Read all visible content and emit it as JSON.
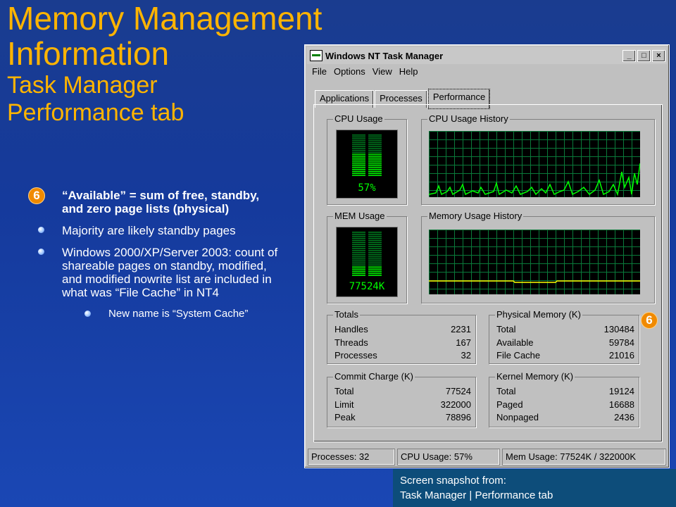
{
  "slide": {
    "title_line1": "Memory Management",
    "title_line2": "Information",
    "subtitle_line1": "Task Manager",
    "subtitle_line2": "Performance tab",
    "badge": "6",
    "bullet_main": "“Available” = sum of free, standby, and zero page lists (physical)",
    "bullet_sub1": "Majority are likely standby pages",
    "bullet_sub2": "Windows 2000/XP/Server 2003: count of shareable pages on standby, modified, and modified nowrite list are included in what was “File Cache” in NT4",
    "bullet_subsub": "New name is “System Cache”",
    "caption_line1": "Screen snapshot from:",
    "caption_line2": "Task Manager | Performance tab"
  },
  "window": {
    "title": "Windows NT Task Manager",
    "minimize": "_",
    "maximize": "□",
    "close": "×",
    "menu": [
      "File",
      "Options",
      "View",
      "Help"
    ],
    "tabs": [
      "Applications",
      "Processes",
      "Performance"
    ],
    "active_tab": "Performance",
    "cpu_usage_label": "CPU Usage",
    "cpu_usage_value": "57%",
    "cpu_history_label": "CPU Usage History",
    "mem_usage_label": "MEM Usage",
    "mem_usage_value": "77524K",
    "mem_history_label": "Memory Usage History",
    "totals": {
      "label": "Totals",
      "rows": [
        {
          "name": "Handles",
          "value": "2231"
        },
        {
          "name": "Threads",
          "value": "167"
        },
        {
          "name": "Processes",
          "value": "32"
        }
      ]
    },
    "physical": {
      "label": "Physical Memory (K)",
      "rows": [
        {
          "name": "Total",
          "value": "130484"
        },
        {
          "name": "Available",
          "value": "59784"
        },
        {
          "name": "File Cache",
          "value": "21016"
        }
      ]
    },
    "commit": {
      "label": "Commit Charge (K)",
      "rows": [
        {
          "name": "Total",
          "value": "77524"
        },
        {
          "name": "Limit",
          "value": "322000"
        },
        {
          "name": "Peak",
          "value": "78896"
        }
      ]
    },
    "kernel": {
      "label": "Kernel Memory (K)",
      "rows": [
        {
          "name": "Total",
          "value": "19124"
        },
        {
          "name": "Paged",
          "value": "16688"
        },
        {
          "name": "Nonpaged",
          "value": "2436"
        }
      ]
    },
    "status": {
      "processes": "Processes: 32",
      "cpu": "CPU Usage: 57%",
      "mem": "Mem Usage: 77524K / 322000K"
    },
    "cpu_meter_level": 0.57,
    "mem_meter_level": 0.24
  },
  "colors": {
    "title": "#ffb400",
    "badge": "#f08a00",
    "graph_green": "#00ff00",
    "memory_line": "#ffff00"
  }
}
